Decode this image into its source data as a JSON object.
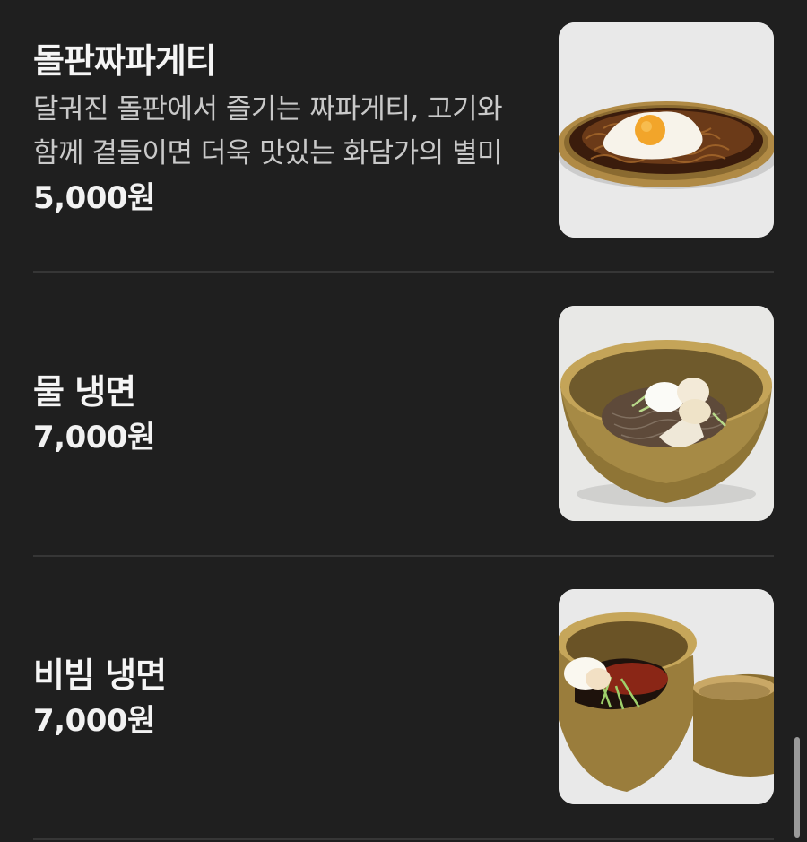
{
  "menu": {
    "items": [
      {
        "name": "돌판짜파게티",
        "description_line1": "달궈진 돌판에서 즐기는 짜파게티, 고기와",
        "description_line2": "함께 곁들이면 더욱 맛있는 화담가의 별미",
        "price": "5,000원",
        "image": "jjapaghetti-photo"
      },
      {
        "name": "물 냉면",
        "price": "7,000원",
        "image": "mul-naengmyeon-photo"
      },
      {
        "name": "비빔 냉면",
        "price": "7,000원",
        "image": "bibim-naengmyeon-photo"
      }
    ]
  },
  "colors": {
    "background": "#1f1f1f",
    "divider": "#363636",
    "text_primary": "#f5f5f5",
    "text_secondary": "#c9c9c9",
    "scrollbar": "#9a9a9a"
  }
}
